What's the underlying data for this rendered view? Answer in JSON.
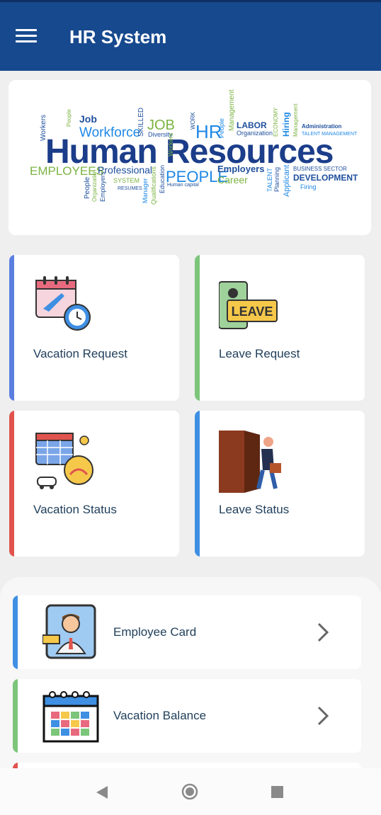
{
  "app_bar": {
    "title": "HR System",
    "menu_icon": "hamburger-menu-icon",
    "color": "#17498e"
  },
  "banner": {
    "headline": "Human Resources",
    "words": {
      "workers": "Workers",
      "job": "Job",
      "workforce": "Workforce",
      "skilled": "SKILLED",
      "job_caps": "JOB",
      "diversity": "Diversity",
      "work": "WORK",
      "hr": "HR",
      "people_small": "People",
      "management": "Management",
      "labor": "LABOR",
      "organization": "Organization",
      "economy": "ECONOMY",
      "hiring": "Hiring",
      "administration": "Administration",
      "talent_management": "TALENT MANAGEMENT",
      "employees": "EMPLOYEES",
      "professional": "Professional",
      "system": "SYSTEM",
      "resumes": "RESUMES",
      "people_caps": "PEOPLE",
      "employers": "Employers",
      "career": "Career",
      "talent": "TALENT",
      "planning": "Planning",
      "applicant": "Applicant",
      "business_sector": "BUSINESS SECTOR",
      "development": "DEVELOPMENT",
      "firing": "Firing",
      "people_v": "People",
      "organization_v": "Organization",
      "employers_v": "Employers",
      "manager": "Manager",
      "qualifications": "Qualifications",
      "education": "Education",
      "human_capital": "Human capital",
      "workers_v": "Workers"
    }
  },
  "tiles": [
    {
      "label": "Vacation Request",
      "accent": "#5b7fe0",
      "icon": "calendar-plane-clock-icon"
    },
    {
      "label": "Leave Request",
      "accent": "#7cc57a",
      "icon": "leave-badge-icon"
    },
    {
      "label": "Vacation Status",
      "accent": "#e0544d",
      "icon": "calendar-beach-car-icon"
    },
    {
      "label": "Leave Status",
      "accent": "#3f8fe3",
      "icon": "door-exit-person-icon"
    }
  ],
  "list": [
    {
      "label": "Employee Card",
      "accent": "#3f8fe3",
      "icon": "employee-id-card-icon"
    },
    {
      "label": "Vacation Balance",
      "accent": "#7cc57a",
      "icon": "calendar-grid-icon"
    },
    {
      "label": "",
      "accent": "#e0544d"
    }
  ],
  "nav": {
    "back_icon": "back-triangle-icon",
    "home_icon": "home-circle-icon",
    "recent_icon": "recent-square-icon"
  }
}
